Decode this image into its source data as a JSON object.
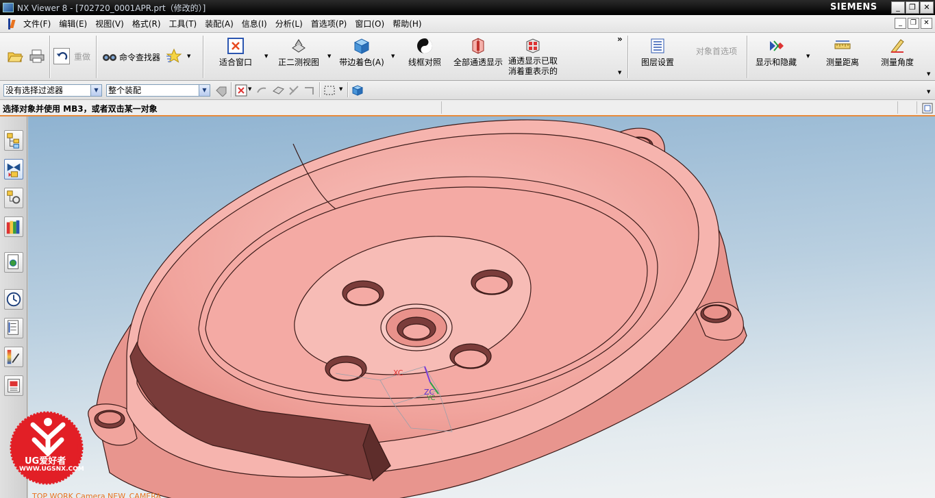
{
  "window": {
    "title": "NX Viewer 8 - [702720_0001APR.prt（修改的）]",
    "brand": "SIEMENS",
    "minimize": "_",
    "maximize": "❐",
    "close": "✕"
  },
  "menu": {
    "items": [
      "文件(F)",
      "编辑(E)",
      "视图(V)",
      "格式(R)",
      "工具(T)",
      "装配(A)",
      "信息(I)",
      "分析(L)",
      "首选项(P)",
      "窗口(O)",
      "帮助(H)"
    ]
  },
  "toolbar": {
    "redo": "重做",
    "command_finder": "命令查找器",
    "fit": "适合窗口",
    "trimetric": "正二测视图",
    "shaded_edges": "带边着色(A)",
    "wireframe": "线框对照",
    "see_thru_all": "全部通透显示",
    "see_thru_line1": "通透显示已取",
    "see_thru_line2": "消着重表示的",
    "layer_settings": "图层设置",
    "object_prefs": "对象首选项",
    "show_hide": "显示和隐藏",
    "measure_distance": "测量距离",
    "measure_angle": "测量角度",
    "more": "»"
  },
  "selection": {
    "filter": "没有选择过滤器",
    "scope": "整个装配"
  },
  "status": {
    "prompt": "选择对象并使用 MB3，或者双击某一对象"
  },
  "viewport": {
    "csys_x": "XC",
    "csys_y": "YC",
    "csys_z": "ZC",
    "label": "TOP WORK Camera NEW_CAMERA"
  },
  "watermark": {
    "text": "UG爱好者",
    "url": "WWW.UGSNX.COM"
  },
  "colors": {
    "part": "#f4a6a0",
    "part_dark": "#7a3c3a",
    "accent": "#e8731f"
  }
}
